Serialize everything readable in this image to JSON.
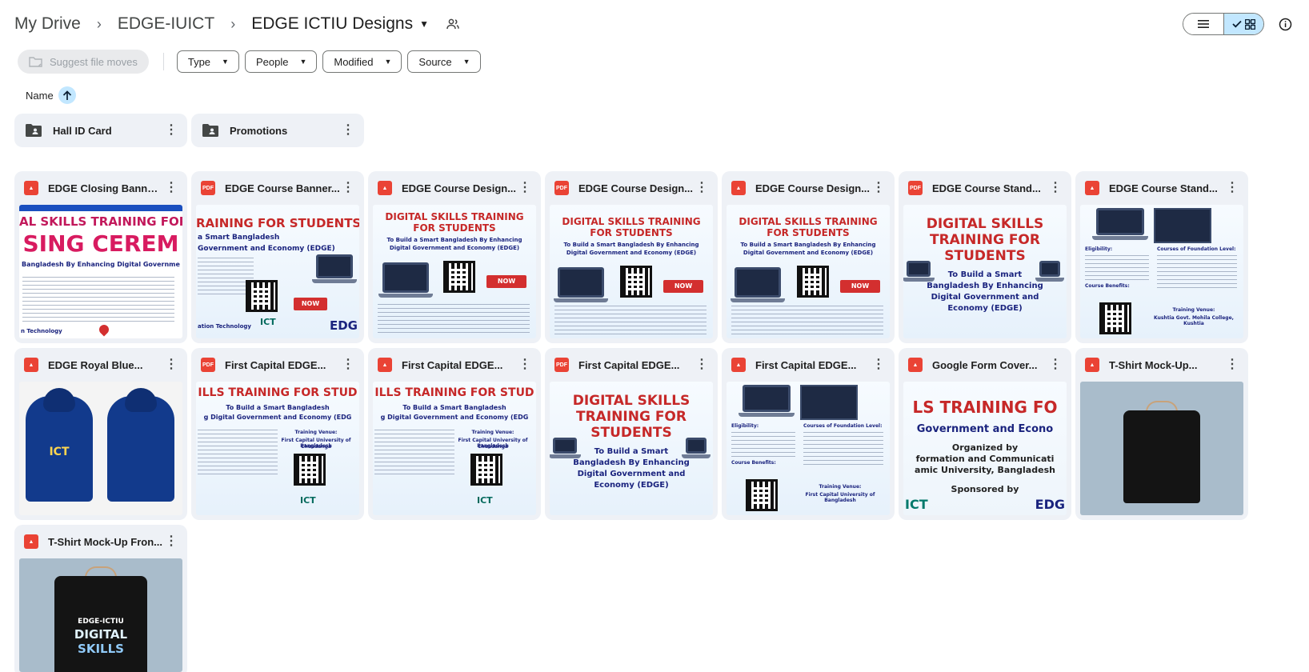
{
  "breadcrumbs": [
    "My Drive",
    "EDGE-IUICT",
    "EDGE ICTIU Designs"
  ],
  "toolbar": {
    "suggest_label": "Suggest file moves",
    "filters": [
      "Type",
      "People",
      "Modified",
      "Source"
    ]
  },
  "sort": {
    "label": "Name"
  },
  "folders": [
    {
      "name": "Hall ID Card",
      "icon": "shared-folder-icon"
    },
    {
      "name": "Promotions",
      "icon": "shared-folder-icon"
    }
  ],
  "files": [
    {
      "name": "EDGE Closing Banner...",
      "type": "image",
      "thumb": {
        "l1": "AL SKILLS TRAINING FOR STU",
        "l2": "SING CEREM",
        "l3": "Bangladesh By Enhancing Digital Governme",
        "l4": "n Technology"
      }
    },
    {
      "name": "EDGE Course Banner...",
      "type": "pdf",
      "thumb": {
        "l1": "RAINING FOR STUDENTS",
        "l2": "a Smart Bangladesh",
        "l3": "Government and Economy (EDGE)",
        "l4": "ation Technology",
        "l5": "ICT",
        "l6": "EDG",
        "l7": "NOW"
      }
    },
    {
      "name": "EDGE Course Design...",
      "type": "image",
      "thumb": {
        "l1": "DIGITAL SKILLS TRAINING",
        "l2": "FOR STUDENTS",
        "l3": "To Build a Smart Bangladesh By Enhancing",
        "l4": "Digital Government and Economy (EDGE)",
        "l5": "NOW"
      }
    },
    {
      "name": "EDGE Course Design...",
      "type": "pdf",
      "thumb": {
        "l1": "DIGITAL SKILLS TRAINING",
        "l2": "FOR STUDENTS",
        "l3": "To Build a Smart Bangladesh By Enhancing",
        "l4": "Digital Government and Economy (EDGE)",
        "l5": "NOW"
      }
    },
    {
      "name": "EDGE Course Design...",
      "type": "image",
      "thumb": {
        "l1": "DIGITAL SKILLS TRAINING",
        "l2": "FOR STUDENTS",
        "l3": "To Build a Smart Bangladesh By Enhancing",
        "l4": "Digital Government and Economy (EDGE)",
        "l5": "NOW"
      }
    },
    {
      "name": "EDGE Course Stand...",
      "type": "pdf",
      "thumb": {
        "l1": "DIGITAL SKILLS",
        "l2": "TRAINING FOR",
        "l3": "STUDENTS",
        "l4": "To Build a Smart",
        "l5": "Bangladesh By Enhancing",
        "l6": "Digital Government and",
        "l7": "Economy (EDGE)"
      }
    },
    {
      "name": "EDGE Course Stand...",
      "type": "image",
      "thumb": {
        "l1": "Eligibility:",
        "l2": "Course Benefits:",
        "l3": "Courses of Foundation Level:",
        "l4": "Training Venue:",
        "l5": "Kushtia Govt. Mohila College, Kushtia"
      }
    },
    {
      "name": "EDGE Royal Blue...",
      "type": "image",
      "thumb": {
        "l1": "ICT"
      }
    },
    {
      "name": "First Capital EDGE...",
      "type": "pdf",
      "thumb": {
        "l1": "ILLS TRAINING FOR STUD",
        "l2": "To Build a Smart Bangladesh",
        "l3": "g Digital Government and Economy (EDG",
        "l4": "Training Venue:",
        "l5": "First Capital University of Bangladesh",
        "l6": "Chuadanga",
        "l7": "ICT"
      }
    },
    {
      "name": "First Capital EDGE...",
      "type": "image",
      "thumb": {
        "l1": "ILLS TRAINING FOR STUD",
        "l2": "To Build a Smart Bangladesh",
        "l3": "g Digital Government and Economy (EDG",
        "l4": "Training Venue:",
        "l5": "First Capital University of Bangladesh",
        "l6": "Chuadanga",
        "l7": "ICT"
      }
    },
    {
      "name": "First Capital EDGE...",
      "type": "pdf",
      "thumb": {
        "l1": "DIGITAL SKILLS",
        "l2": "TRAINING FOR",
        "l3": "STUDENTS",
        "l4": "To Build a Smart",
        "l5": "Bangladesh By Enhancing",
        "l6": "Digital Government and",
        "l7": "Economy (EDGE)"
      }
    },
    {
      "name": "First Capital EDGE...",
      "type": "image",
      "thumb": {
        "l1": "Eligibility:",
        "l2": "Course Benefits:",
        "l3": "Courses of Foundation Level:",
        "l4": "Training Venue:",
        "l5": "First Capital University of Bangladesh"
      }
    },
    {
      "name": "Google Form Cover...",
      "type": "image",
      "thumb": {
        "l1": "LS TRAINING FO",
        "l2": "Government and Econo",
        "l3": "Organized by",
        "l4": "formation and Communicati",
        "l5": "amic University, Bangladesh",
        "l6": "Sponsored by",
        "l7": "ICT",
        "l8": "EDG"
      }
    },
    {
      "name": "T-Shirt Mock-Up...",
      "type": "image",
      "thumb": {}
    },
    {
      "name": "T-Shirt Mock-Up Fron...",
      "type": "image",
      "thumb": {
        "l1": "EDGE-ICTIU",
        "l2": "DIGITAL",
        "l3": "SKILLS"
      }
    }
  ],
  "colors": {
    "accent": "#c2e7ff",
    "card_bg": "#eef1f6",
    "image_icon": "#ea4335"
  }
}
